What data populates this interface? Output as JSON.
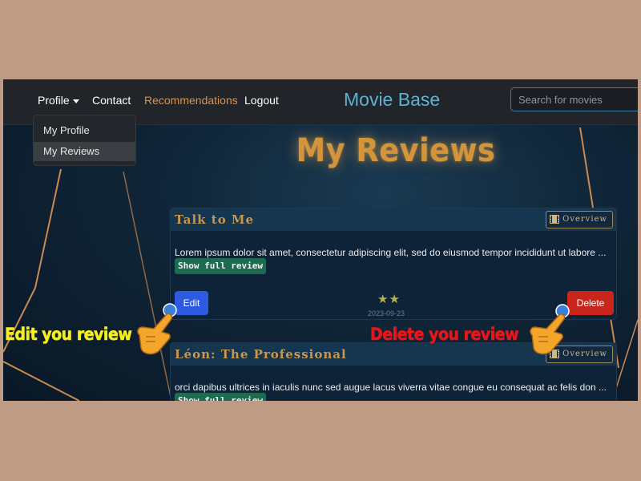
{
  "navbar": {
    "profile_label": "Profile",
    "contact_label": "Contact",
    "recommendations_label": "Recommendations",
    "logout_label": "Logout",
    "brand": "Movie Base",
    "search_placeholder": "Search for movies"
  },
  "profile_dropdown": {
    "items": [
      {
        "label": "My Profile"
      },
      {
        "label": "My Reviews"
      }
    ]
  },
  "page_title": "My Reviews",
  "reviews": [
    {
      "title": "Talk to Me",
      "overview_label": "Overview",
      "excerpt": "Lorem ipsum dolor sit amet, consectetur adipiscing elit, sed do eiusmod tempor incididunt ut labore ...",
      "show_full_label": "Show full review",
      "edit_label": "Edit",
      "delete_label": "Delete",
      "rating_stars": "★★",
      "rating": 2,
      "date": "2023-09-23"
    },
    {
      "title": "Léon: The Professional",
      "overview_label": "Overview",
      "excerpt": "orci dapibus ultrices in iaculis nunc sed augue lacus viverra vitae congue eu consequat ac felis don ...",
      "show_full_label": "Show full review"
    }
  ],
  "annotations": {
    "edit_callout": "Edit you review",
    "delete_callout": "Delete you review"
  },
  "colors": {
    "outer_background": "#bf9a85",
    "navbar_background": "#212529",
    "brand": "#5bb3d4",
    "active_nav": "#d9924a",
    "title_gold": "#d4943a",
    "edit_button": "#2d5ae0",
    "delete_button": "#c8261c",
    "show_full_badge": "#1f6b52",
    "edit_callout": "#f5ef20",
    "delete_callout": "#e8161a"
  },
  "icons": [
    "caret-down-icon",
    "film-icon",
    "pointing-hand-icon"
  ]
}
